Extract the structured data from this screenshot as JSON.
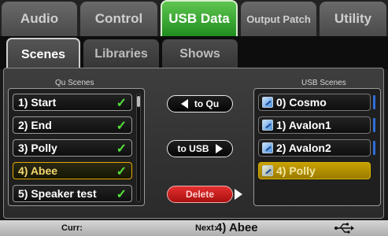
{
  "top_tabs": {
    "audio": "Audio",
    "control": "Control",
    "usb_data": "USB Data",
    "output_patch": "Output Patch",
    "utility": "Utility"
  },
  "sub_tabs": {
    "scenes": "Scenes",
    "libraries": "Libraries",
    "shows": "Shows"
  },
  "qu_scenes": {
    "label": "Qu Scenes",
    "items": [
      {
        "text": "1) Start",
        "check": "✓"
      },
      {
        "text": "2) End",
        "check": "✓"
      },
      {
        "text": "3) Polly",
        "check": "✓"
      },
      {
        "text": "4) Abee",
        "check": "✓"
      },
      {
        "text": "5) Speaker test",
        "check": "✓"
      }
    ]
  },
  "usb_scenes": {
    "label": "USB Scenes",
    "items": [
      {
        "text": "0) Cosmo"
      },
      {
        "text": "1) Avalon1"
      },
      {
        "text": "2) Avalon2"
      },
      {
        "text": "4) Polly"
      }
    ]
  },
  "buttons": {
    "to_qu": "to Qu",
    "to_usb": "to USB",
    "delete": "Delete"
  },
  "status_bar": {
    "curr_label": "Curr:",
    "next_label": "Next:",
    "next_value": "4) Abee"
  },
  "colors": {
    "active_tab": "#3aa83a",
    "selected_outline": "#e6a800",
    "check_green": "#55e23c",
    "delete_red": "#d22020",
    "highlight_gold": "#b89100"
  },
  "icons": [
    "usb-scene-icon",
    "usb-connection-icon",
    "arrow-left-icon",
    "arrow-right-icon"
  ]
}
